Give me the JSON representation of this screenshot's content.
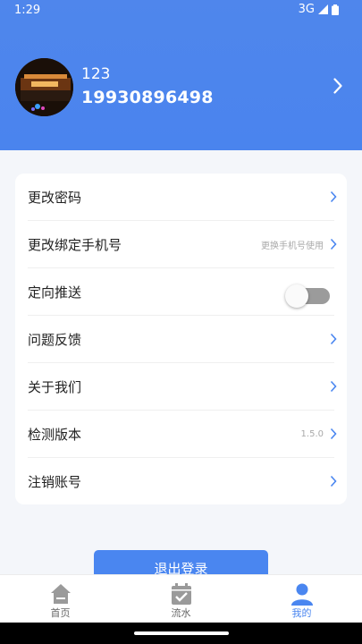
{
  "status_bar": {
    "time": "1:29",
    "network": "3G"
  },
  "profile": {
    "name": "123",
    "phone": "19930896498"
  },
  "settings": {
    "items": [
      {
        "label": "更改密码",
        "hint": ""
      },
      {
        "label": "更改绑定手机号",
        "hint": "更换手机号使用"
      },
      {
        "label": "定向推送",
        "hint": "",
        "toggle_on": false
      },
      {
        "label": "问题反馈",
        "hint": ""
      },
      {
        "label": "关于我们",
        "hint": ""
      },
      {
        "label": "检测版本",
        "hint": "1.5.0"
      },
      {
        "label": "注销账号",
        "hint": ""
      }
    ]
  },
  "logout_label": "退出登录",
  "tabs": [
    {
      "label": "首页",
      "icon": "home-icon",
      "active": false
    },
    {
      "label": "流水",
      "icon": "calendar-check-icon",
      "active": false
    },
    {
      "label": "我的",
      "icon": "user-icon",
      "active": true
    }
  ],
  "colors": {
    "accent": "#4a86f0",
    "header": "#4f86ec",
    "background": "#f4f6fa"
  }
}
